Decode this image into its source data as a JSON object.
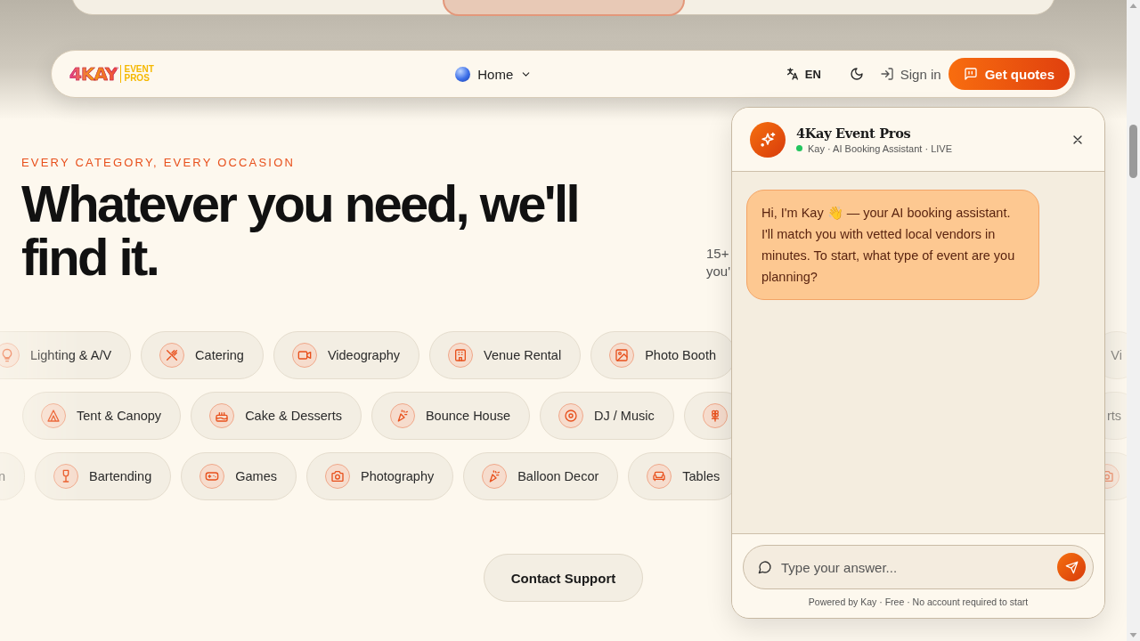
{
  "nav": {
    "brand": {
      "mark": "4KAY",
      "lines": [
        "EVENT",
        "PROS"
      ]
    },
    "menu": {
      "label": "Home"
    },
    "language": "EN",
    "sign_in": "Sign in",
    "cta": "Get quotes"
  },
  "hero": {
    "eyebrow": "EVERY CATEGORY, EVERY OCCASION",
    "headline": "Whatever you need, we'll find it.",
    "subtitle_lines": [
      "15+",
      "you'"
    ]
  },
  "category_rows": [
    {
      "chips": [
        {
          "kind": "text",
          "label": "Lighting & A/V"
        },
        {
          "kind": "text",
          "label": "Catering"
        },
        {
          "kind": "text",
          "label": "Videography"
        },
        {
          "kind": "text",
          "label": "Venue Rental"
        },
        {
          "kind": "text",
          "label": "Photo Booth"
        }
      ],
      "trailing": {
        "kind": "text",
        "label": "Vi"
      }
    },
    {
      "chips": [
        {
          "kind": "text",
          "label": "Tent & Canopy"
        },
        {
          "kind": "text",
          "label": "Cake & Desserts"
        },
        {
          "kind": "text",
          "label": "Bounce House"
        },
        {
          "kind": "text",
          "label": "DJ / Music"
        },
        {
          "kind": "icon_only"
        }
      ],
      "trailing": {
        "kind": "text",
        "label": "rts"
      }
    },
    {
      "chips": [
        {
          "kind": "text",
          "label": "n"
        },
        {
          "kind": "text",
          "label": "Bartending"
        },
        {
          "kind": "text",
          "label": "Games"
        },
        {
          "kind": "text",
          "label": "Photography"
        },
        {
          "kind": "text",
          "label": "Balloon Decor"
        },
        {
          "kind": "text",
          "label": "Tables"
        }
      ],
      "trailing": {
        "kind": "icon_only"
      }
    }
  ],
  "support_button": "Contact Support",
  "chat": {
    "title": "4Kay Event Pros",
    "status": "Kay · AI Booking Assistant · LIVE",
    "online": true,
    "messages": [
      {
        "text": "Hi, I'm Kay 👋 — your AI booking assistant. I'll match you with vetted local vendors in minutes. To start, what type of event are you planning?"
      }
    ],
    "input": {
      "placeholder": "Type your answer..."
    },
    "footer": "Powered by Kay · Free · No account required to start"
  }
}
